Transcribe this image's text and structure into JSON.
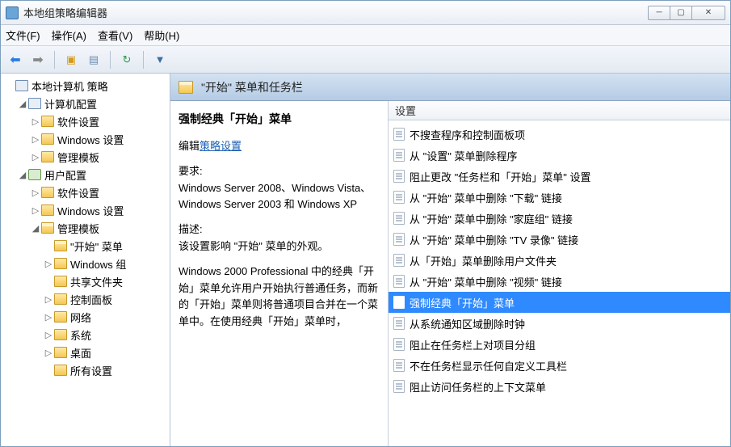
{
  "window": {
    "title": "本地组策略编辑器"
  },
  "menu": {
    "file": "文件(F)",
    "action": "操作(A)",
    "view": "查看(V)",
    "help": "帮助(H)"
  },
  "tree": {
    "root": "本地计算机 策略",
    "computer": "计算机配置",
    "comp_software": "软件设置",
    "comp_windows": "Windows 设置",
    "comp_admin": "管理模板",
    "user": "用户配置",
    "user_software": "软件设置",
    "user_windows": "Windows 设置",
    "user_admin": "管理模板",
    "start_menu": "\"开始\" 菜单",
    "windows_comp": "Windows 组",
    "shared_folders": "共享文件夹",
    "control_panel": "控制面板",
    "network": "网络",
    "system": "系统",
    "desktop": "桌面",
    "all_settings": "所有设置"
  },
  "header": {
    "title": "\"开始\" 菜单和任务栏"
  },
  "detail": {
    "title": "强制经典「开始」菜单",
    "edit_prefix": "编辑",
    "edit_link": "策略设置",
    "req_label": "要求:",
    "req_text": "Windows Server 2008、Windows Vista、Windows Server 2003 和 Windows XP",
    "desc_label": "描述:",
    "desc_text": "该设置影响 \"开始\" 菜单的外观。",
    "desc_text2": "Windows 2000 Professional 中的经典「开始」菜单允许用户开始执行普通任务，而新的「开始」菜单则将普通项目合并在一个菜单中。在使用经典「开始」菜单时，"
  },
  "list": {
    "header": "设置",
    "items": [
      "不搜查程序和控制面板项",
      "从 \"设置\" 菜单删除程序",
      "阻止更改 \"任务栏和「开始」菜单\" 设置",
      "从 \"开始\" 菜单中删除 \"下载\" 链接",
      "从 \"开始\" 菜单中删除 \"家庭组\" 链接",
      "从 \"开始\" 菜单中删除 \"TV 录像\" 链接",
      "从「开始」菜单删除用户文件夹",
      "从 \"开始\" 菜单中删除 \"视频\" 链接",
      "强制经典「开始」菜单",
      "从系统通知区域删除时钟",
      "阻止在任务栏上对项目分组",
      "不在任务栏显示任何自定义工具栏",
      "阻止访问任务栏的上下文菜单"
    ],
    "selected_index": 8
  }
}
